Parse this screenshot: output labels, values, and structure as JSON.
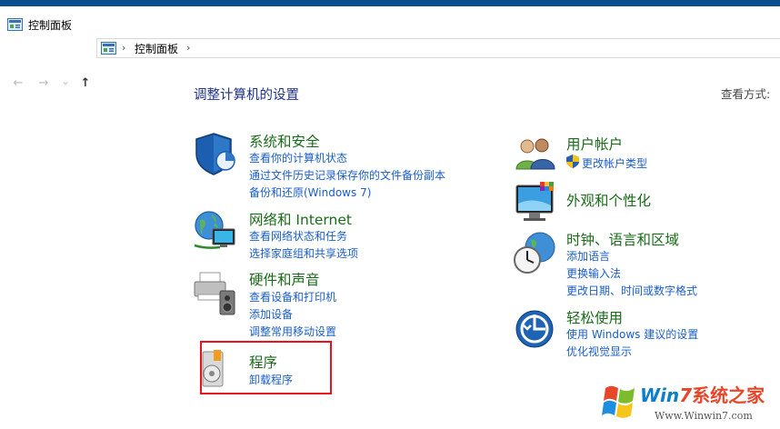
{
  "window": {
    "title": "控制面板"
  },
  "nav": {
    "back": "←",
    "forward": "→",
    "dropdown": "⌄",
    "up": "↑",
    "separator": "›",
    "breadcrumb": "控制面板"
  },
  "main": {
    "heading": "调整计算机的设置",
    "view_by": "查看方式:"
  },
  "categories": {
    "security": {
      "title": "系统和安全",
      "links": [
        "查看你的计算机状态",
        "通过文件历史记录保存你的文件备份副本",
        "备份和还原(Windows 7)"
      ]
    },
    "network": {
      "title": "网络和 Internet",
      "links": [
        "查看网络状态和任务",
        "选择家庭组和共享选项"
      ]
    },
    "hardware": {
      "title": "硬件和声音",
      "links": [
        "查看设备和打印机",
        "添加设备",
        "调整常用移动设置"
      ]
    },
    "programs": {
      "title": "程序",
      "links": [
        "卸载程序"
      ]
    },
    "users": {
      "title": "用户帐户",
      "links": [
        "更改帐户类型"
      ]
    },
    "appearance": {
      "title": "外观和个性化",
      "links": []
    },
    "clock": {
      "title": "时钟、语言和区域",
      "links": [
        "添加语言",
        "更换输入法",
        "更改日期、时间或数字格式"
      ]
    },
    "ease": {
      "title": "轻松使用",
      "links": [
        "使用 Windows 建议的设置",
        "优化视觉显示"
      ]
    }
  },
  "watermark": {
    "brand_win": "Win",
    "brand_seven": "7",
    "brand_cn": "系统之家",
    "url": "Www.Winwin7.com"
  },
  "colors": {
    "category_title": "#1a6b1a",
    "link": "#1a5ec8",
    "heading": "#1e3287",
    "highlight_box": "#e8141b",
    "title_strip": "#0b4e8f"
  }
}
